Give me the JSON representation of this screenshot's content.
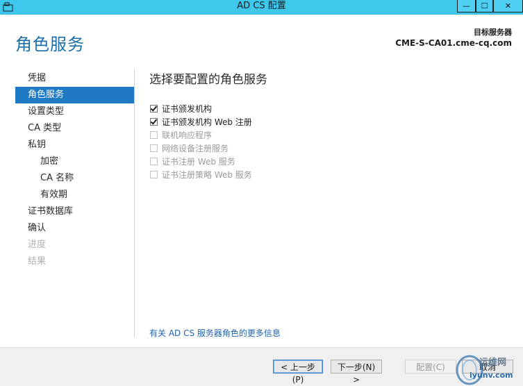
{
  "window": {
    "title": "AD CS 配置",
    "buttons": {
      "minimize": "—",
      "maximize": "☐",
      "close": "✕"
    }
  },
  "header": {
    "page_title": "角色服务",
    "target_label": "目标服务器",
    "target_value": "CME-S-CA01.cme-cq.com"
  },
  "nav": {
    "items": [
      {
        "label": "凭据",
        "state": "normal",
        "level": 0
      },
      {
        "label": "角色服务",
        "state": "active",
        "level": 0
      },
      {
        "label": "设置类型",
        "state": "normal",
        "level": 0
      },
      {
        "label": "CA 类型",
        "state": "normal",
        "level": 0
      },
      {
        "label": "私钥",
        "state": "normal",
        "level": 0
      },
      {
        "label": "加密",
        "state": "normal",
        "level": 1
      },
      {
        "label": "CA 名称",
        "state": "normal",
        "level": 1
      },
      {
        "label": "有效期",
        "state": "normal",
        "level": 1
      },
      {
        "label": "证书数据库",
        "state": "normal",
        "level": 0
      },
      {
        "label": "确认",
        "state": "normal",
        "level": 0
      },
      {
        "label": "进度",
        "state": "disabled",
        "level": 0
      },
      {
        "label": "结果",
        "state": "disabled",
        "level": 0
      }
    ]
  },
  "main": {
    "heading": "选择要配置的角色服务",
    "roles": [
      {
        "label": "证书颁发机构",
        "checked": true,
        "enabled": true
      },
      {
        "label": "证书颁发机构 Web 注册",
        "checked": true,
        "enabled": true
      },
      {
        "label": "联机响应程序",
        "checked": false,
        "enabled": false
      },
      {
        "label": "网络设备注册服务",
        "checked": false,
        "enabled": false
      },
      {
        "label": "证书注册 Web 服务",
        "checked": false,
        "enabled": false
      },
      {
        "label": "证书注册策略 Web 服务",
        "checked": false,
        "enabled": false
      }
    ],
    "more_link": "有关 AD CS 服务器角色的更多信息"
  },
  "footer": {
    "prev": "< 上一步(P)",
    "next": "下一步(N) >",
    "configure": "配置(C)",
    "cancel": "取消"
  },
  "watermark": {
    "line1": "运维网",
    "line2": "iyunv.com"
  }
}
